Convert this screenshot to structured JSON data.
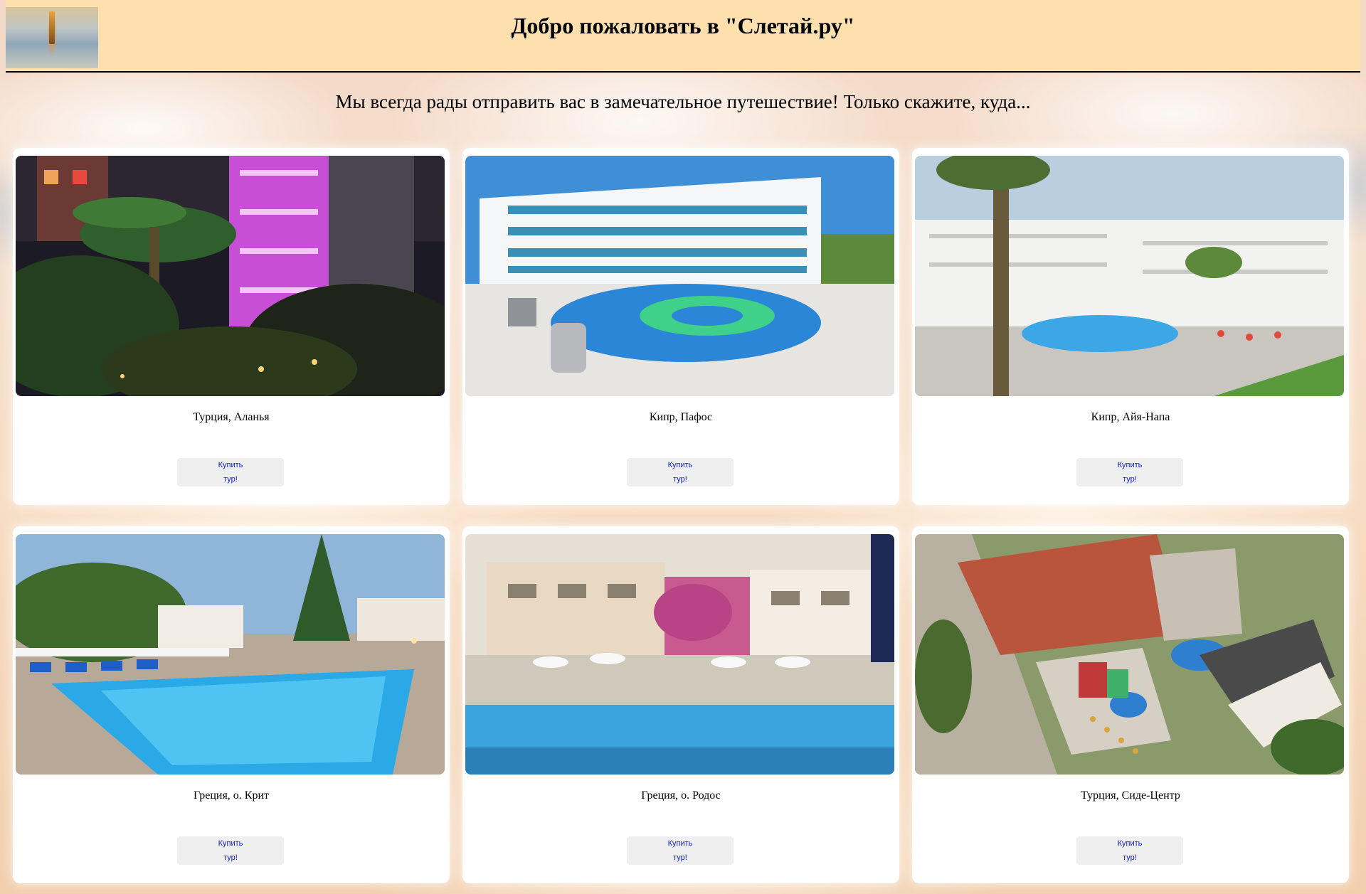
{
  "header": {
    "title": "Добро пожаловать в \"Слетай.ру\"",
    "logo_icon": "eiffel-tower-reflection-logo"
  },
  "tagline": "Мы всегда рады отправить вас в замечательное путешествие! Только скажите, куда...",
  "tours": [
    {
      "caption": "Турция, Аланья",
      "button_line1": "Купить",
      "button_line2": "тур!",
      "photo": "night-hotel-palms-purple-lights"
    },
    {
      "caption": "Кипр, Пафос",
      "button_line1": "Купить",
      "button_line2": "тур!",
      "photo": "white-hotel-round-pool"
    },
    {
      "caption": "Кипр, Айя-Напа",
      "button_line1": "Купить",
      "button_line2": "тур!",
      "photo": "white-hotel-palm-pool"
    },
    {
      "caption": "Греция, о. Крит",
      "button_line1": "Купить",
      "button_line2": "тур!",
      "photo": "evening-pool-sunbeds"
    },
    {
      "caption": "Греция, о. Родос",
      "button_line1": "Купить",
      "button_line2": "тур!",
      "photo": "hotel-pool-umbrellas"
    },
    {
      "caption": "Турция, Сиде-Центр",
      "button_line1": "Купить",
      "button_line2": "тур!",
      "photo": "aerial-hotel-waterslides"
    }
  ],
  "colors": {
    "header_bg": "#fedfae",
    "button_text": "#0b1fcc",
    "button_bg": "#efefef"
  }
}
